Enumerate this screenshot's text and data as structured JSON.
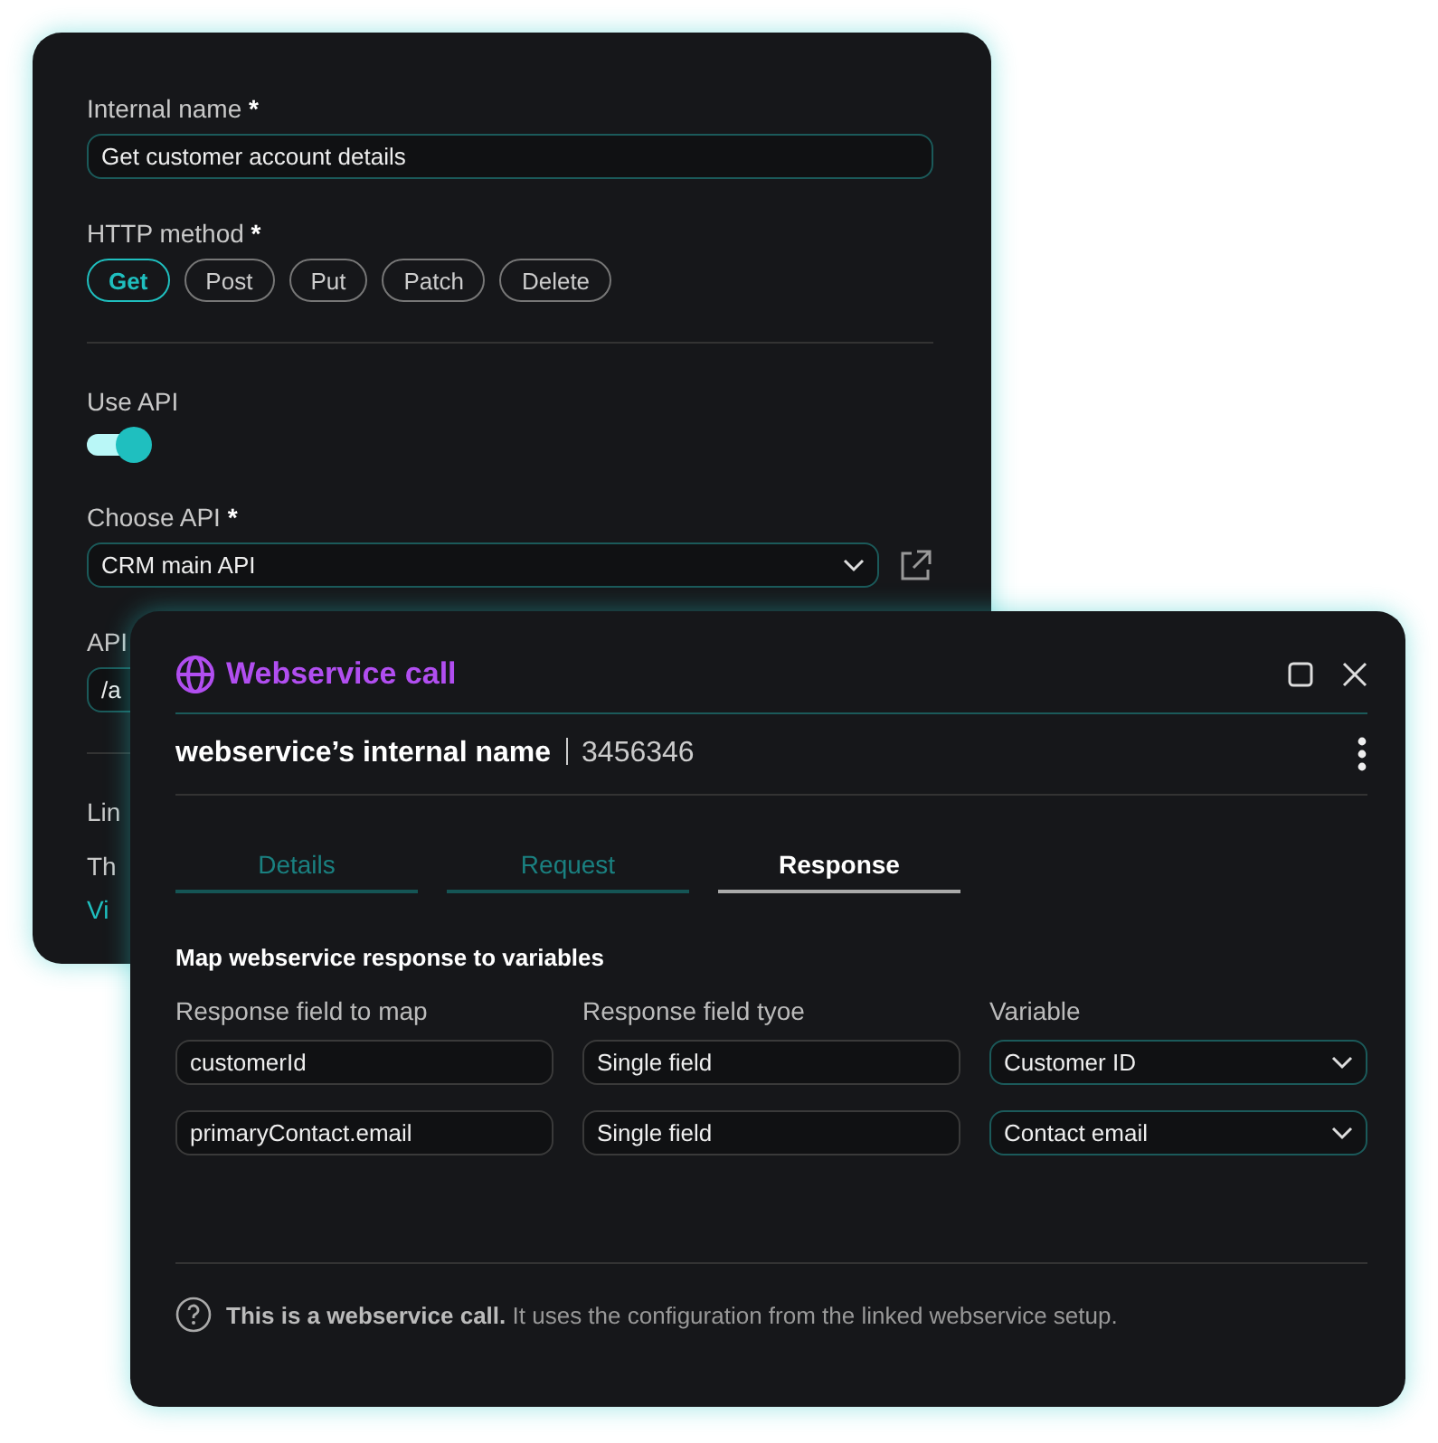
{
  "settings_panel": {
    "internal_name": {
      "label": "Internal name",
      "required_mark": "*",
      "value": "Get customer account details"
    },
    "http_method": {
      "label": "HTTP method",
      "required_mark": "*",
      "options": [
        {
          "label": "Get",
          "selected": true
        },
        {
          "label": "Post",
          "selected": false
        },
        {
          "label": "Put",
          "selected": false
        },
        {
          "label": "Patch",
          "selected": false
        },
        {
          "label": "Delete",
          "selected": false
        }
      ]
    },
    "use_api": {
      "label": "Use API",
      "on": true
    },
    "choose_api": {
      "label": "Choose API",
      "required_mark": "*",
      "value": "CRM main API"
    },
    "api_field": {
      "label": "API",
      "value": "/a"
    },
    "section_label": "Lin",
    "section_text": "Th",
    "section_link": "Vi"
  },
  "dialog": {
    "title": "Webservice call",
    "name": "webservice’s internal name",
    "id": "3456346",
    "tabs": [
      {
        "label": "Details",
        "selected": false
      },
      {
        "label": "Request",
        "selected": false
      },
      {
        "label": "Response",
        "selected": true
      }
    ],
    "section_title": "Map webservice response to variables",
    "columns": [
      "Response field to map",
      "Response field tyoe",
      "Variable"
    ],
    "rows": [
      {
        "field": "customerId",
        "type": "Single field",
        "variable": "Customer ID"
      },
      {
        "field": "primaryContact.email",
        "type": "Single field",
        "variable": "Contact email"
      }
    ],
    "footer": "**This is a webservice call.** It uses the configuration from the linked webservice setup."
  }
}
